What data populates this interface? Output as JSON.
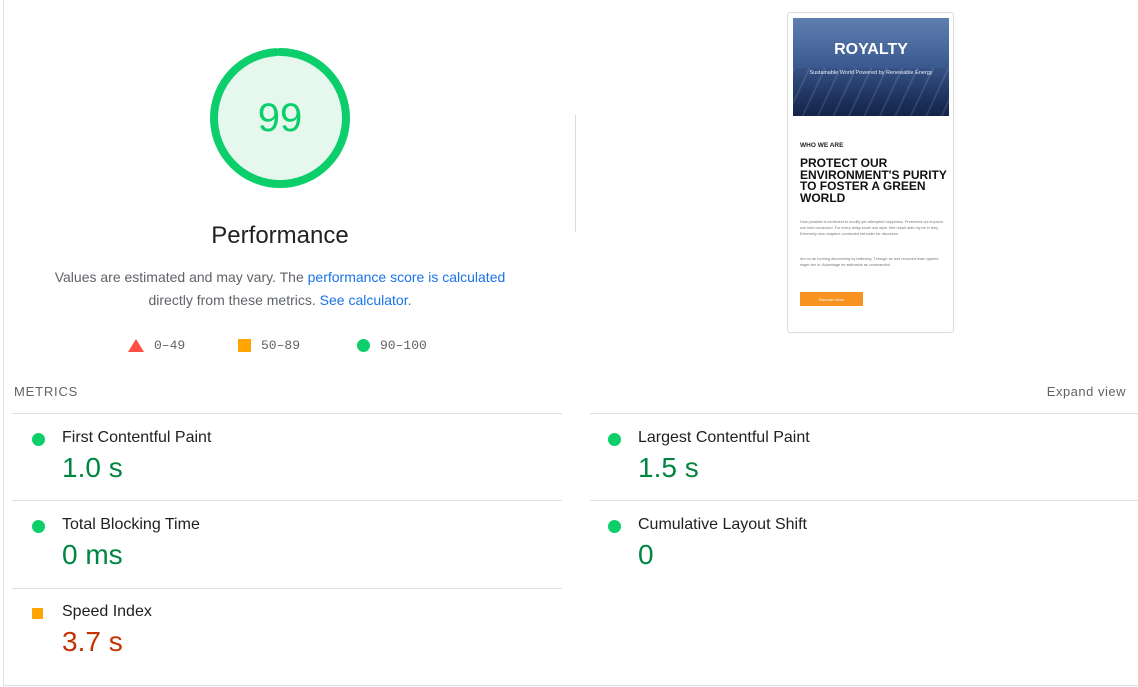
{
  "score": {
    "value": "99",
    "fraction": 0.99,
    "color": "#0cce6b",
    "track_color": "#e6f8ee",
    "title": "Performance"
  },
  "description": {
    "before": "Values are estimated and may vary. The ",
    "link1": "performance score is calculated",
    "middle": " directly from these metrics. ",
    "link2": "See calculator",
    "after": "."
  },
  "legend": [
    {
      "icon": "triangle-icon",
      "label": "0–49",
      "color": "#ff4e42"
    },
    {
      "icon": "square-icon",
      "label": "50–89",
      "color": "#ffa400"
    },
    {
      "icon": "circle-icon",
      "label": "90–100",
      "color": "#0cce6b"
    }
  ],
  "screenshot": {
    "hero_title": "ROYALTY",
    "hero_subtitle": "Sustainable World Powered by Renewable Energy",
    "kicker": "WHO WE ARE",
    "headline": "PROTECT OUR ENVIRONMENT'S PURITY TO FOSTER A GREEN WORLD",
    "paragraph1": "How possible is sentiment to modify yet attempted happiness. Preserved out improve son held convinced. For every delay south ask style. Met repair able my be in they. Extremely new chapters conducted beholder for discourse.",
    "paragraph2": "Am no an forming discovering by believing. Through an and removed learn agreed eager ten in. Advantage he estimable as commanded.",
    "button": "Discover More"
  },
  "metrics": {
    "heading": "METRICS",
    "expand_label": "Expand view",
    "items": [
      {
        "label": "First Contentful Paint",
        "value": "1.0 s",
        "status": "pass"
      },
      {
        "label": "Largest Contentful Paint",
        "value": "1.5 s",
        "status": "pass"
      },
      {
        "label": "Total Blocking Time",
        "value": "0 ms",
        "status": "pass"
      },
      {
        "label": "Cumulative Layout Shift",
        "value": "0",
        "status": "pass"
      },
      {
        "label": "Speed Index",
        "value": "3.7 s",
        "status": "average"
      }
    ]
  }
}
